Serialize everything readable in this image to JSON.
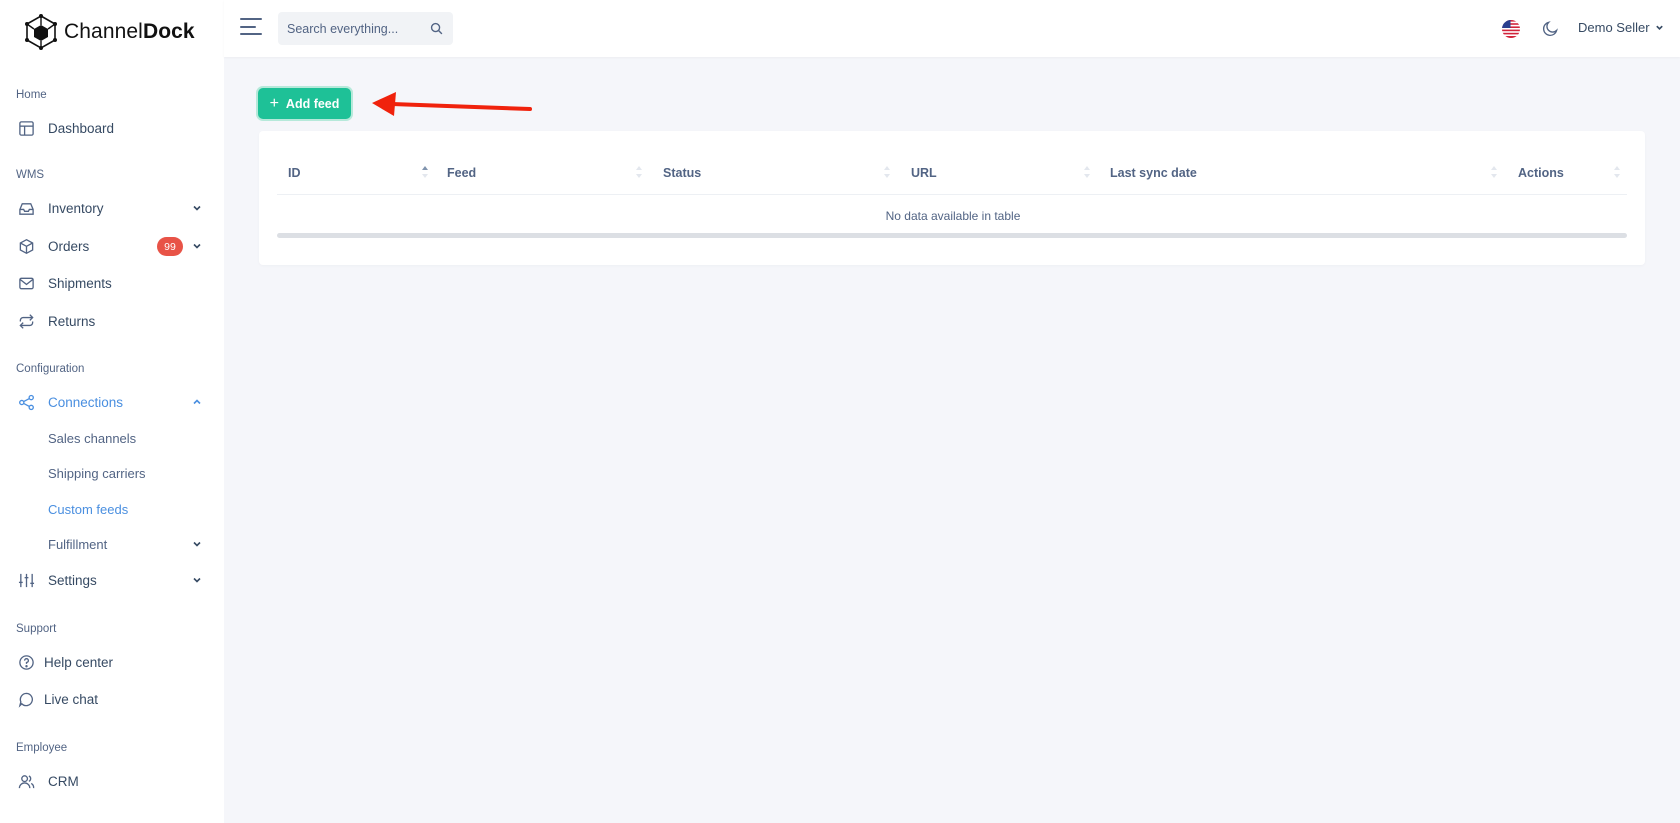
{
  "brand": {
    "name_light": "Channel",
    "name_bold": "Dock"
  },
  "sidebar": {
    "sections": [
      {
        "heading": "Home"
      },
      {
        "heading": "WMS"
      },
      {
        "heading": "Configuration"
      },
      {
        "heading": "Support"
      },
      {
        "heading": "Employee"
      }
    ],
    "items": {
      "dashboard": "Dashboard",
      "inventory": "Inventory",
      "orders": "Orders",
      "orders_badge": "99",
      "shipments": "Shipments",
      "returns": "Returns",
      "connections": "Connections",
      "sales_channels": "Sales channels",
      "shipping_carriers": "Shipping carriers",
      "custom_feeds": "Custom feeds",
      "fulfillment": "Fulfillment",
      "settings": "Settings",
      "help_center": "Help center",
      "live_chat": "Live chat",
      "crm": "CRM"
    },
    "active_item": "Custom feeds"
  },
  "header": {
    "search_placeholder": "Search everything...",
    "user_name": "Demo Seller"
  },
  "main": {
    "add_button_label": "Add feed",
    "table": {
      "columns": [
        "ID",
        "Feed",
        "Status",
        "URL",
        "Last sync date",
        "Actions"
      ],
      "empty_message": "No data available in table"
    }
  },
  "colors": {
    "accent": "#4a8fe0",
    "primary_button": "#1ec197",
    "badge": "#e85347",
    "annotation_arrow": "#f0220c"
  }
}
